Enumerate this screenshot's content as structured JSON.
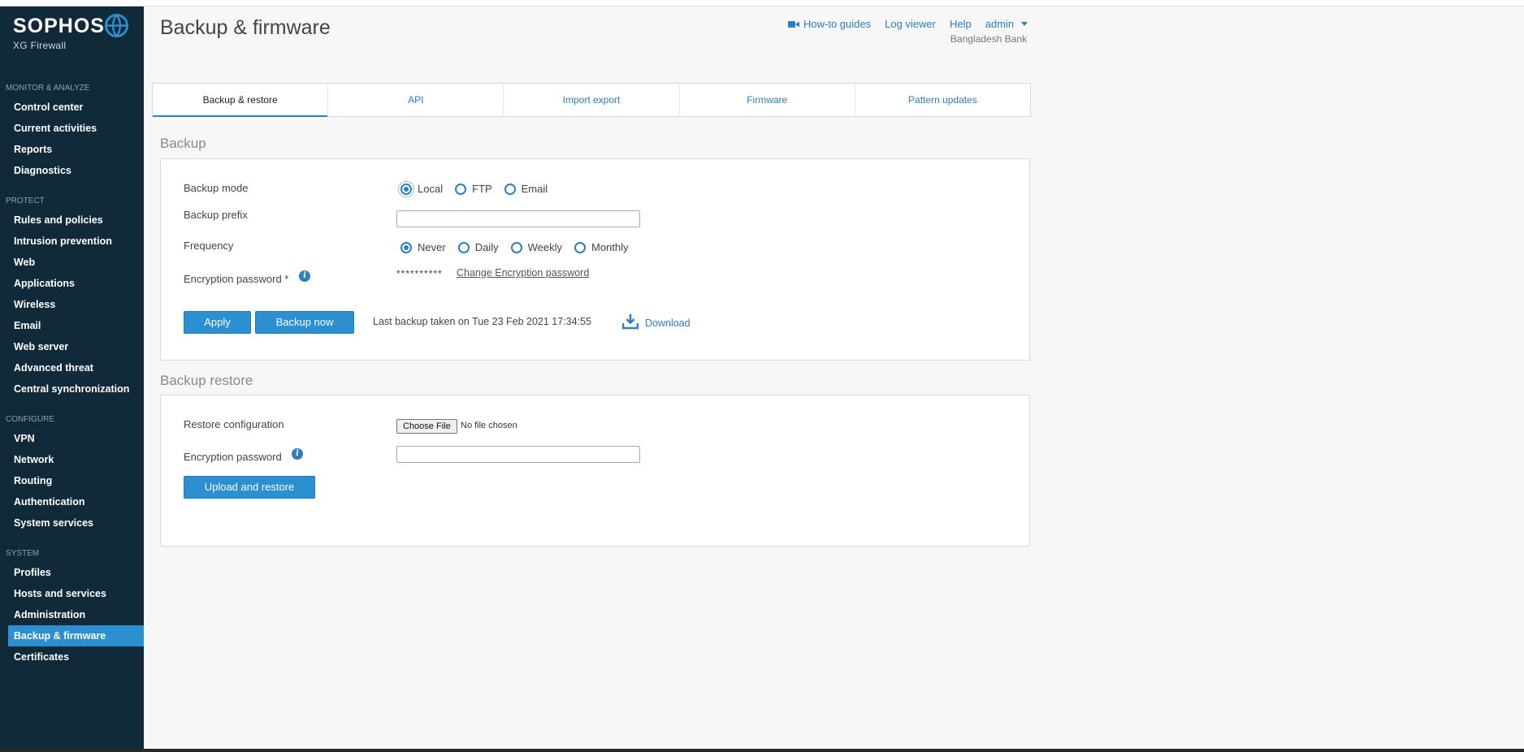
{
  "brand": {
    "name": "SOPHOS",
    "product": "XG Firewall"
  },
  "sidebar": {
    "sections": [
      {
        "title": "MONITOR & ANALYZE",
        "items": [
          "Control center",
          "Current activities",
          "Reports",
          "Diagnostics"
        ]
      },
      {
        "title": "PROTECT",
        "items": [
          "Rules and policies",
          "Intrusion prevention",
          "Web",
          "Applications",
          "Wireless",
          "Email",
          "Web server",
          "Advanced threat",
          "Central synchronization"
        ]
      },
      {
        "title": "CONFIGURE",
        "items": [
          "VPN",
          "Network",
          "Routing",
          "Authentication",
          "System services"
        ]
      },
      {
        "title": "SYSTEM",
        "items": [
          "Profiles",
          "Hosts and services",
          "Administration",
          "Backup & firmware",
          "Certificates"
        ]
      }
    ],
    "active": "Backup & firmware"
  },
  "header": {
    "title": "Backup & firmware",
    "links": {
      "howto": "How-to guides",
      "logviewer": "Log viewer",
      "help": "Help",
      "user": "admin"
    },
    "org": "Bangladesh Bank"
  },
  "tabs": [
    "Backup & restore",
    "API",
    "Import export",
    "Firmware",
    "Pattern updates"
  ],
  "active_tab": "Backup & restore",
  "backup": {
    "section_title": "Backup",
    "mode_label": "Backup mode",
    "modes": [
      "Local",
      "FTP",
      "Email"
    ],
    "mode_selected": "Local",
    "prefix_label": "Backup prefix",
    "prefix_value": "",
    "frequency_label": "Frequency",
    "frequencies": [
      "Never",
      "Daily",
      "Weekly",
      "Monthly"
    ],
    "frequency_selected": "Never",
    "enc_label": "Encryption password *",
    "enc_masked": "**********",
    "enc_change": "Change Encryption password",
    "apply": "Apply",
    "backup_now": "Backup now",
    "last_backup": "Last backup taken on Tue 23 Feb 2021 17:34:55",
    "download": "Download"
  },
  "restore": {
    "section_title": "Backup restore",
    "config_label": "Restore configuration",
    "choose_file": "Choose File",
    "no_file": "No file chosen",
    "enc_label": "Encryption password",
    "enc_value": "",
    "upload": "Upload and restore"
  }
}
